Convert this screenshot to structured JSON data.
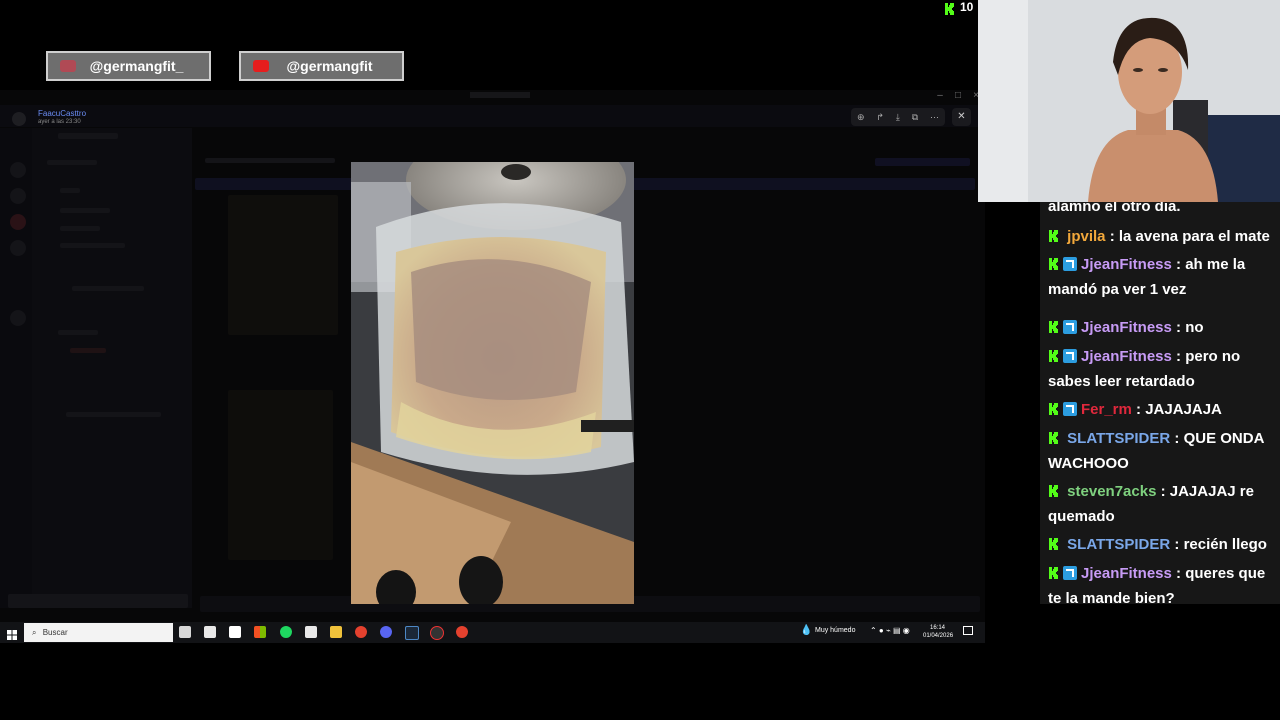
{
  "overlay": {
    "viewer_count": "10",
    "instagram_handle": "@germangfit_",
    "youtube_handle": "@germangfit"
  },
  "discord": {
    "sender_name": "FaacuCasttro",
    "sender_time": "ayer a las 23:30"
  },
  "taskbar": {
    "search_placeholder": "Buscar",
    "weather": "Muy húmedo",
    "time": "16:14",
    "date": "01/04/2026"
  },
  "chat": {
    "partial_top": "alamno el otro dia.",
    "messages": [
      {
        "user": "jpvila",
        "color": "#f2a83b",
        "prime": false,
        "text": ": la avena para el mate"
      },
      {
        "user": "JjeanFitness",
        "color": "#c79bf5",
        "prime": true,
        "text": ": ah me la mandó pa ver 1 vez"
      },
      {
        "user": "JjeanFitness",
        "color": "#c79bf5",
        "prime": true,
        "text": ": no"
      },
      {
        "user": "JjeanFitness",
        "color": "#c79bf5",
        "prime": true,
        "text": ": pero no sabes leer retardado"
      },
      {
        "user": "Fer_rm",
        "color": "#e0283c",
        "prime": true,
        "text": ": JAJAJAJA"
      },
      {
        "user": "SLATTSPIDER",
        "color": "#7aa7e8",
        "prime": false,
        "text": ": QUE ONDA WACHOOO"
      },
      {
        "user": "steven7acks",
        "color": "#7fd17f",
        "prime": false,
        "text": ": JAJAJAJ re quemado"
      },
      {
        "user": "SLATTSPIDER",
        "color": "#7aa7e8",
        "prime": false,
        "text": ": recién llego"
      },
      {
        "user": "JjeanFitness",
        "color": "#c79bf5",
        "prime": true,
        "text": ": queres que te la mande bien?"
      }
    ]
  },
  "colors": {
    "kick_green": "#53fc18",
    "prime_blue": "#2c9de0"
  }
}
